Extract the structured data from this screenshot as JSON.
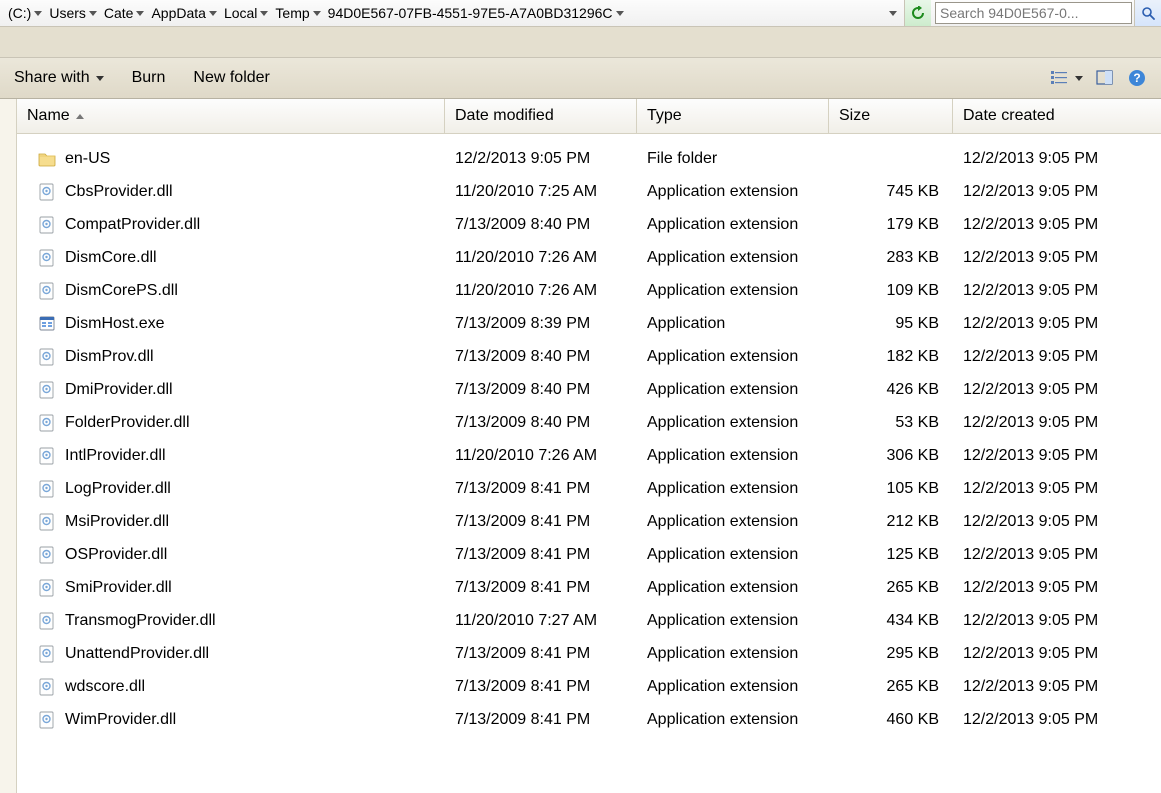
{
  "breadcrumbs": [
    {
      "label": "(C:)"
    },
    {
      "label": "Users"
    },
    {
      "label": "Cate"
    },
    {
      "label": "AppData"
    },
    {
      "label": "Local"
    },
    {
      "label": "Temp"
    },
    {
      "label": "94D0E567-07FB-4551-97E5-A7A0BD31296C"
    }
  ],
  "search_placeholder": "Search 94D0E567-0...",
  "toolbar": {
    "share_label": "Share with",
    "burn_label": "Burn",
    "newfolder_label": "New folder"
  },
  "columns": {
    "name": "Name",
    "date": "Date modified",
    "type": "Type",
    "size": "Size",
    "created": "Date created"
  },
  "files": [
    {
      "icon": "folder",
      "name": "en-US",
      "date": "12/2/2013 9:05 PM",
      "type": "File folder",
      "size": "",
      "created": "12/2/2013 9:05 PM"
    },
    {
      "icon": "dll",
      "name": "CbsProvider.dll",
      "date": "11/20/2010 7:25 AM",
      "type": "Application extension",
      "size": "745 KB",
      "created": "12/2/2013 9:05 PM"
    },
    {
      "icon": "dll",
      "name": "CompatProvider.dll",
      "date": "7/13/2009 8:40 PM",
      "type": "Application extension",
      "size": "179 KB",
      "created": "12/2/2013 9:05 PM"
    },
    {
      "icon": "dll",
      "name": "DismCore.dll",
      "date": "11/20/2010 7:26 AM",
      "type": "Application extension",
      "size": "283 KB",
      "created": "12/2/2013 9:05 PM"
    },
    {
      "icon": "dll",
      "name": "DismCorePS.dll",
      "date": "11/20/2010 7:26 AM",
      "type": "Application extension",
      "size": "109 KB",
      "created": "12/2/2013 9:05 PM"
    },
    {
      "icon": "exe",
      "name": "DismHost.exe",
      "date": "7/13/2009 8:39 PM",
      "type": "Application",
      "size": "95 KB",
      "created": "12/2/2013 9:05 PM"
    },
    {
      "icon": "dll",
      "name": "DismProv.dll",
      "date": "7/13/2009 8:40 PM",
      "type": "Application extension",
      "size": "182 KB",
      "created": "12/2/2013 9:05 PM"
    },
    {
      "icon": "dll",
      "name": "DmiProvider.dll",
      "date": "7/13/2009 8:40 PM",
      "type": "Application extension",
      "size": "426 KB",
      "created": "12/2/2013 9:05 PM"
    },
    {
      "icon": "dll",
      "name": "FolderProvider.dll",
      "date": "7/13/2009 8:40 PM",
      "type": "Application extension",
      "size": "53 KB",
      "created": "12/2/2013 9:05 PM"
    },
    {
      "icon": "dll",
      "name": "IntlProvider.dll",
      "date": "11/20/2010 7:26 AM",
      "type": "Application extension",
      "size": "306 KB",
      "created": "12/2/2013 9:05 PM"
    },
    {
      "icon": "dll",
      "name": "LogProvider.dll",
      "date": "7/13/2009 8:41 PM",
      "type": "Application extension",
      "size": "105 KB",
      "created": "12/2/2013 9:05 PM"
    },
    {
      "icon": "dll",
      "name": "MsiProvider.dll",
      "date": "7/13/2009 8:41 PM",
      "type": "Application extension",
      "size": "212 KB",
      "created": "12/2/2013 9:05 PM"
    },
    {
      "icon": "dll",
      "name": "OSProvider.dll",
      "date": "7/13/2009 8:41 PM",
      "type": "Application extension",
      "size": "125 KB",
      "created": "12/2/2013 9:05 PM"
    },
    {
      "icon": "dll",
      "name": "SmiProvider.dll",
      "date": "7/13/2009 8:41 PM",
      "type": "Application extension",
      "size": "265 KB",
      "created": "12/2/2013 9:05 PM"
    },
    {
      "icon": "dll",
      "name": "TransmogProvider.dll",
      "date": "11/20/2010 7:27 AM",
      "type": "Application extension",
      "size": "434 KB",
      "created": "12/2/2013 9:05 PM"
    },
    {
      "icon": "dll",
      "name": "UnattendProvider.dll",
      "date": "7/13/2009 8:41 PM",
      "type": "Application extension",
      "size": "295 KB",
      "created": "12/2/2013 9:05 PM"
    },
    {
      "icon": "dll",
      "name": "wdscore.dll",
      "date": "7/13/2009 8:41 PM",
      "type": "Application extension",
      "size": "265 KB",
      "created": "12/2/2013 9:05 PM"
    },
    {
      "icon": "dll",
      "name": "WimProvider.dll",
      "date": "7/13/2009 8:41 PM",
      "type": "Application extension",
      "size": "460 KB",
      "created": "12/2/2013 9:05 PM"
    }
  ]
}
